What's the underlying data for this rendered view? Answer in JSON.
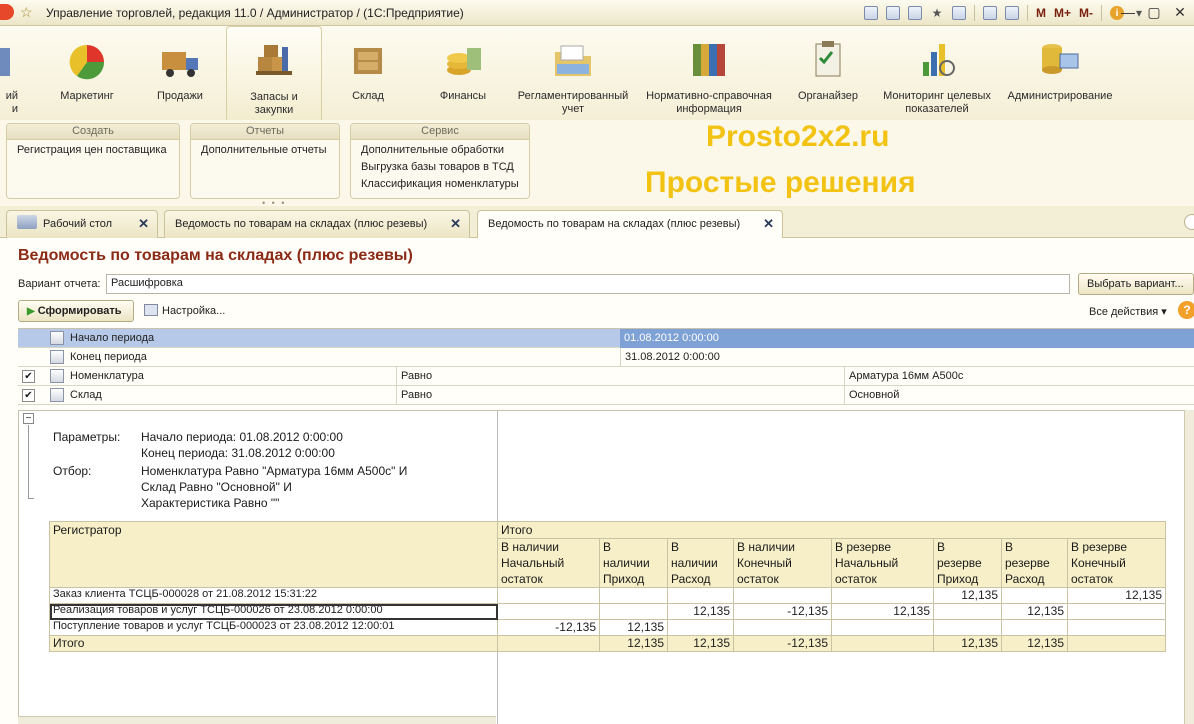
{
  "window": {
    "title": "Управление торговлей, редакция 11.0 / Администратор /  (1С:Предприятие)",
    "toolbar_text": [
      "M",
      "M+",
      "M-"
    ]
  },
  "sections": [
    {
      "label": "...ий\n...и",
      "icon": "partial-section-icon"
    },
    {
      "label": "Маркетинг",
      "icon": "pie-chart-icon"
    },
    {
      "label": "Продажи",
      "icon": "truck-icon"
    },
    {
      "label": "Запасы и\nзакупки",
      "icon": "boxes-icon",
      "active": true
    },
    {
      "label": "Склад",
      "icon": "warehouse-icon"
    },
    {
      "label": "Финансы",
      "icon": "coins-icon"
    },
    {
      "label": "Регламентированный\nучет",
      "icon": "folder-docs-icon"
    },
    {
      "label": "Нормативно-справочная\nинформация",
      "icon": "binders-icon"
    },
    {
      "label": "Органайзер",
      "icon": "clipboard-icon"
    },
    {
      "label": "Мониторинг целевых\nпоказателей",
      "icon": "bar-chart-icon"
    },
    {
      "label": "Администрирование",
      "icon": "server-icon"
    }
  ],
  "groups": [
    {
      "title": "Создать",
      "items": [
        "Регистрация цен поставщика"
      ]
    },
    {
      "title": "Отчеты",
      "items": [
        "Дополнительные отчеты"
      ]
    },
    {
      "title": "Сервис",
      "items": [
        "Дополнительные обработки",
        "Выгрузка базы товаров в ТСД",
        "Классификация номенклатуры"
      ]
    }
  ],
  "promo": {
    "line1": "Prosto2x2.ru",
    "line2": "Простые решения"
  },
  "tabs": [
    {
      "label": "Рабочий стол"
    },
    {
      "label": "Ведомость по товарам на складах (плюс резевы)"
    },
    {
      "label": "Ведомость по товарам на складах (плюс резевы)",
      "active": true
    }
  ],
  "form": {
    "title": "Ведомость по товарам на складах (плюс резевы)",
    "variant_label": "Вариант отчета:",
    "variant_value": "Расшифровка",
    "choose_variant": "Выбрать вариант...",
    "run_button": "Сформировать",
    "settings_link": "Настройка...",
    "all_actions": "Все действия",
    "help": "?"
  },
  "settings_rows": [
    {
      "checked": null,
      "name": "Начало периода",
      "condition": "",
      "value": "01.08.2012 0:00:00",
      "selected": true
    },
    {
      "checked": null,
      "name": "Конец периода",
      "condition": "",
      "value": "31.08.2012 0:00:00"
    },
    {
      "checked": true,
      "name": "Номенклатура",
      "condition": "Равно",
      "value": "Арматура 16мм А500с"
    },
    {
      "checked": true,
      "name": "Склад",
      "condition": "Равно",
      "value": "Основной"
    }
  ],
  "params": {
    "params_label": "Параметры:",
    "start": "Начало периода: 01.08.2012 0:00:00",
    "end": "Конец периода: 31.08.2012 0:00:00",
    "filter_label": "Отбор:",
    "filter_lines": [
      "Номенклатура Равно \"Арматура 16мм А500с\" И",
      "Склад Равно \"Основной\" И",
      "Характеристика Равно \"\""
    ]
  },
  "report": {
    "registrar_header": "Регистратор",
    "total_header": "Итого",
    "columns": [
      "В наличии\nНачальный\nостаток",
      "В\nналичии\nПриход",
      "В\nналичии\nРасход",
      "В наличии\nКонечный\nостаток",
      "В резерве\nНачальный\nостаток",
      "В\nрезерве\nПриход",
      "В\nрезерве\nРасход",
      "В резерве\nКонечный\nостаток"
    ],
    "rows": [
      {
        "name": "Заказ клиента ТСЦБ-000028 от 21.08.2012 15:31:22",
        "values": [
          "",
          "",
          "",
          "",
          "",
          "12,135",
          "",
          "12,135"
        ]
      },
      {
        "name": "Реализация товаров и услуг ТСЦБ-000026 от 23.08.2012 0:00:00",
        "values": [
          "",
          "",
          "12,135",
          "-12,135",
          "12,135",
          "",
          "12,135",
          ""
        ],
        "boxed": true
      },
      {
        "name": "Поступление товаров и услуг ТСЦБ-000023 от 23.08.2012 12:00:01",
        "values": [
          "-12,135",
          "12,135",
          "",
          "",
          "",
          "",
          "",
          ""
        ]
      }
    ],
    "total_row": {
      "name": "Итого",
      "values": [
        "",
        "12,135",
        "12,135",
        "-12,135",
        "",
        "12,135",
        "12,135",
        ""
      ]
    }
  }
}
